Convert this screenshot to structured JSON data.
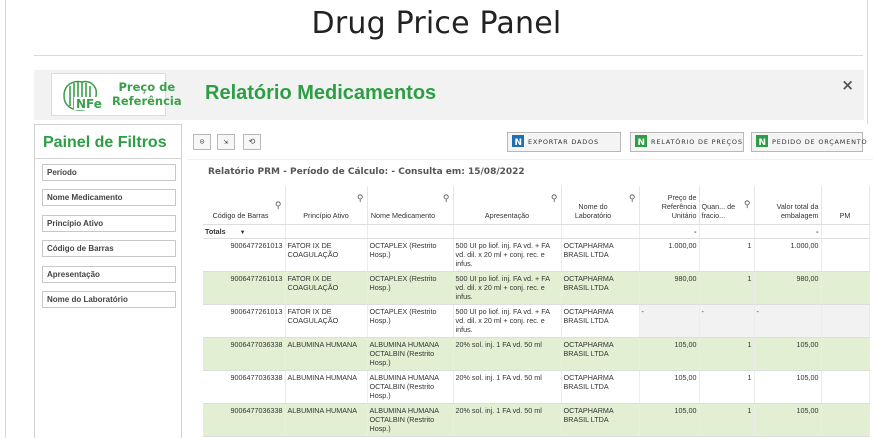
{
  "page": {
    "title": "Drug Price Panel"
  },
  "header": {
    "logo_line1": "Preço de",
    "logo_line2": "Referência",
    "logo_mark": "NFe",
    "report_title": "Relatório Medicamentos",
    "close_symbol": "×"
  },
  "filters": {
    "title": "Painel de Filtros",
    "items": [
      "Período",
      "Nome Medicamento",
      "Princípio Ativo",
      "Código de Barras",
      "Apresentação",
      "Nome do Laboratório"
    ]
  },
  "toolbar": {
    "export_label": "EXPORTAR DADOS",
    "price_report_label": "RELATÓRIO DE PREÇOS",
    "budget_label": "PEDIDO DE ORÇAMENTO"
  },
  "table": {
    "caption": "Relatório PRM - Período de Cálculo: - Consulta em: 15/08/2022",
    "headers": {
      "barcode": "Código de Barras",
      "active": "Princípio Ativo",
      "drug": "Nome Medicamento",
      "presentation": "Apresentação",
      "lab": "Nome do Laboratório",
      "ref_price": "Preço de Referência Unitário",
      "qty": "Quan... de fracio...",
      "total": "Valor total da embalagem",
      "extra": "PM"
    },
    "totals_label": "Totals",
    "totals_dash": "-",
    "rows": [
      {
        "barcode": "9006477261013",
        "active": "FATOR IX DE COAGULAÇÃO",
        "drug": "OCTAPLEX (Restrito Hosp.)",
        "presentation": "500 UI po liof. inj. FA vd. + FA vd. dil. x 20 ml + conj. rec. e infus.",
        "lab": "OCTAPHARMA BRASIL LTDA",
        "ref_price": "1.000,00",
        "qty": "1",
        "total": "1.000,00"
      },
      {
        "barcode": "9006477261013",
        "active": "FATOR IX DE COAGULAÇÃO",
        "drug": "OCTAPLEX (Restrito Hosp.)",
        "presentation": "500 UI po liof. inj. FA vd. + FA vd. dil. x 20 ml + conj. rec. e infus.",
        "lab": "OCTAPHARMA BRASIL LTDA",
        "ref_price": "980,00",
        "qty": "1",
        "total": "980,00"
      },
      {
        "barcode": "9006477261013",
        "active": "FATOR IX DE COAGULAÇÃO",
        "drug": "OCTAPLEX (Restrito Hosp.)",
        "presentation": "500 UI po liof. inj. FA vd. + FA vd. dil. x 20 ml + conj. rec. e infus.",
        "lab": "OCTAPHARMA BRASIL LTDA",
        "ref_price": "-",
        "qty": "-",
        "total": "-"
      },
      {
        "barcode": "9006477036338",
        "active": "ALBUMINA HUMANA",
        "drug": "ALBUMINA HUMANA OCTALBIN (Restrito Hosp.)",
        "presentation": "20% sol. inj. 1 FA vd. 50 ml",
        "lab": "OCTAPHARMA BRASIL LTDA",
        "ref_price": "105,00",
        "qty": "1",
        "total": "105,00"
      },
      {
        "barcode": "9006477036338",
        "active": "ALBUMINA HUMANA",
        "drug": "ALBUMINA HUMANA OCTALBIN (Restrito Hosp.)",
        "presentation": "20% sol. inj. 1 FA vd. 50 ml",
        "lab": "OCTAPHARMA BRASIL LTDA",
        "ref_price": "105,00",
        "qty": "1",
        "total": "105,00"
      },
      {
        "barcode": "9006477036338",
        "active": "ALBUMINA HUMANA",
        "drug": "ALBUMINA HUMANA OCTALBIN (Restrito Hosp.)",
        "presentation": "20% sol. inj. 1 FA vd. 50 ml",
        "lab": "OCTAPHARMA BRASIL LTDA",
        "ref_price": "105,00",
        "qty": "1",
        "total": "105,00"
      }
    ]
  },
  "colors": {
    "brand_green": "#2d9e45",
    "row_highlight": "#e3efd3"
  },
  "icons": [
    "search-icon",
    "sort-down-icon",
    "excel-icon",
    "close-icon"
  ]
}
